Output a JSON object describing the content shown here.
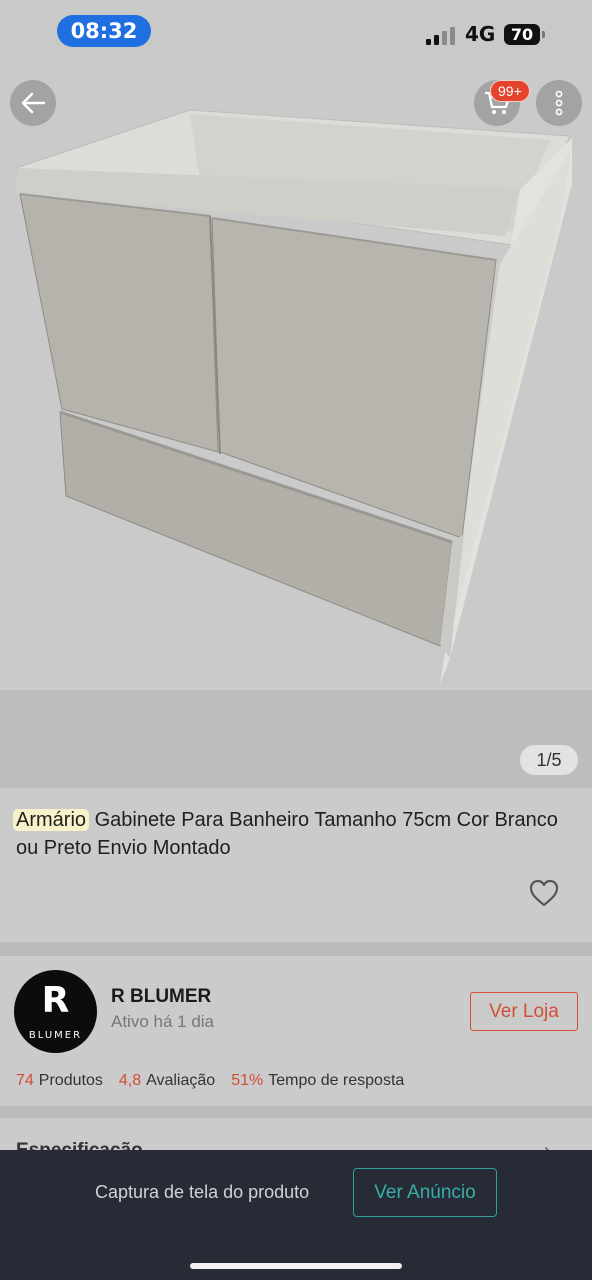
{
  "status_bar": {
    "time": "08:32",
    "network": "4G",
    "battery": "70"
  },
  "header": {
    "back_icon": "arrow-left-icon",
    "cart_icon": "cart-icon",
    "cart_badge": "99+",
    "more_icon": "more-vertical-icon"
  },
  "gallery": {
    "counter": "1/5"
  },
  "product": {
    "title_highlight": "Armário",
    "title_rest": "Gabinete Para Banheiro Tamanho 75cm Cor Branco ou Preto Envio Montado",
    "favorite_icon": "heart-icon"
  },
  "seller": {
    "avatar_letter": "R",
    "avatar_word": "BLUMER",
    "name": "R BLUMER",
    "active": "Ativo há 1 dia",
    "store_button": "Ver Loja",
    "stats": [
      {
        "value": "74",
        "label": "Produtos"
      },
      {
        "value": "4,8",
        "label": "Avaliação"
      },
      {
        "value": "51%",
        "label": "Tempo de resposta"
      }
    ]
  },
  "specs": {
    "title": "Especificação"
  },
  "bottom_bar": {
    "text": "Captura de tela do produto",
    "button": "Ver Anúncio"
  },
  "colors": {
    "accent": "#d24e35",
    "teal": "#2fa39a",
    "time_pill": "#1f6fe0"
  }
}
